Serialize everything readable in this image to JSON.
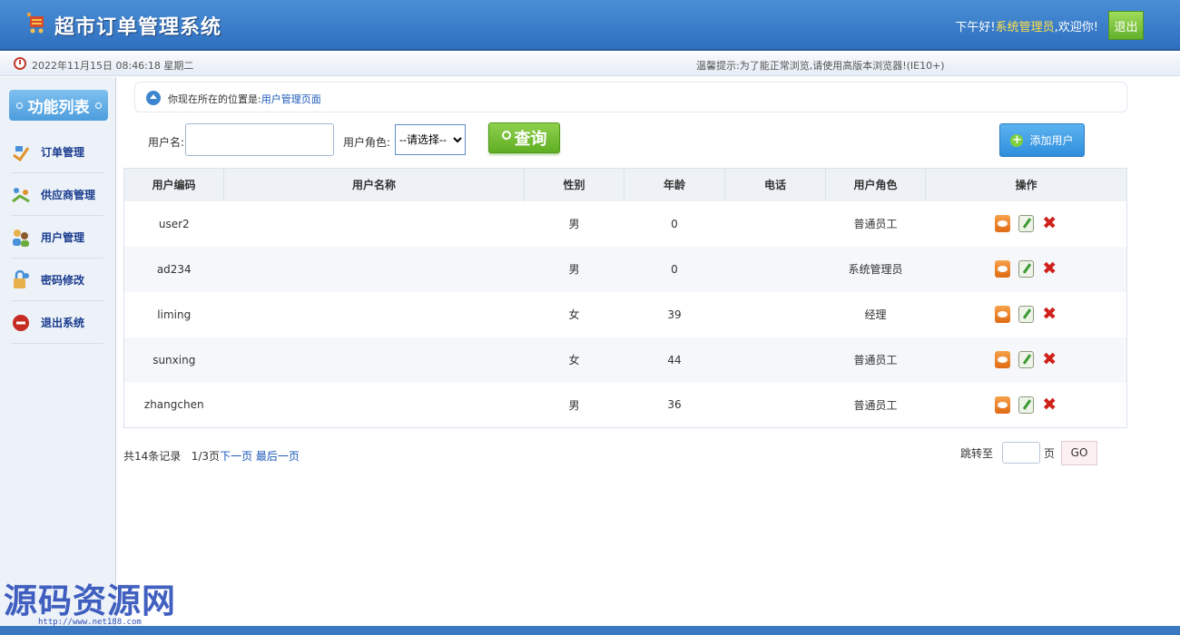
{
  "header": {
    "title": "超市订单管理系统",
    "greeting_prefix": "下午好!",
    "username": "系统管理员",
    "greeting_suffix": ",欢迎你!",
    "logout_label": "退出"
  },
  "infobar": {
    "datetime": "2022年11月15日 08:46:18 星期二",
    "tip": "温馨提示:为了能正常浏览,请使用高版本浏览器!(IE10+)"
  },
  "sidebar": {
    "title": "功能列表",
    "items": [
      {
        "label": "订单管理",
        "icon": "order-icon"
      },
      {
        "label": "供应商管理",
        "icon": "provider-icon"
      },
      {
        "label": "用户管理",
        "icon": "users-icon"
      },
      {
        "label": "密码修改",
        "icon": "password-icon"
      },
      {
        "label": "退出系统",
        "icon": "exit-icon"
      }
    ]
  },
  "breadcrumb": {
    "prefix": "你现在所在的位置是:",
    "current": "用户管理页面"
  },
  "search": {
    "username_label": "用户名:",
    "username_value": "",
    "role_label": "用户角色:",
    "role_selected": "--请选择--",
    "query_label": "查询",
    "add_label": "添加用户"
  },
  "table": {
    "columns": [
      "用户编码",
      "用户名称",
      "性别",
      "年龄",
      "电话",
      "用户角色",
      "操作"
    ],
    "rows": [
      {
        "code": "user2",
        "name": "",
        "gender": "男",
        "age": "0",
        "phone": "",
        "role": "普通员工"
      },
      {
        "code": "ad234",
        "name": "",
        "gender": "男",
        "age": "0",
        "phone": "",
        "role": "系统管理员"
      },
      {
        "code": "liming",
        "name": "",
        "gender": "女",
        "age": "39",
        "phone": "",
        "role": "经理"
      },
      {
        "code": "sunxing",
        "name": "",
        "gender": "女",
        "age": "44",
        "phone": "",
        "role": "普通员工"
      },
      {
        "code": "zhangchen",
        "name": "",
        "gender": "男",
        "age": "36",
        "phone": "",
        "role": "普通员工"
      }
    ]
  },
  "pager": {
    "total": "共14条记录",
    "page": "1/3页",
    "next": "下一页",
    "last": "最后一页",
    "jump_label": "跳转至",
    "page_unit": "页",
    "go_label": "GO"
  },
  "watermark": {
    "text": "源码资源网",
    "url": "http://www.net188.com"
  },
  "colors": {
    "header": "#2f6fbf",
    "accent_green": "#5fae23",
    "link": "#1a58b8"
  }
}
